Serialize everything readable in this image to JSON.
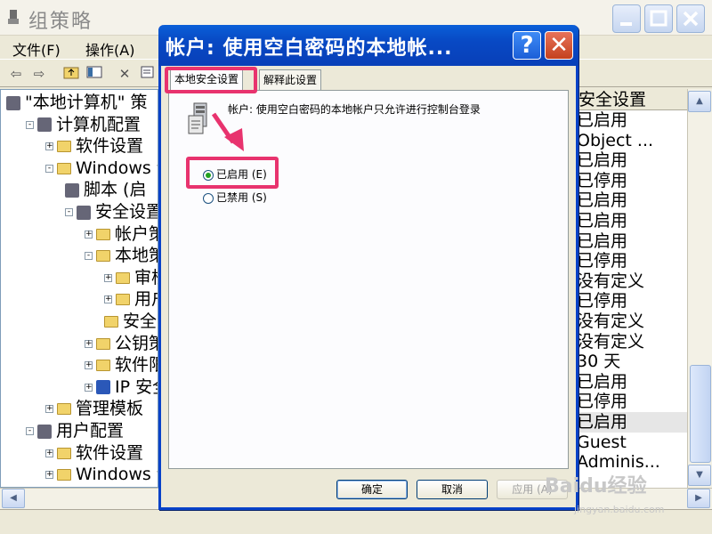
{
  "main_window": {
    "title": "组策略",
    "menu": [
      "文件(F)",
      "操作(A)"
    ],
    "toolbar_icons": [
      "back-arrow-icon",
      "forward-arrow-icon",
      "up-folder-icon",
      "show-hide-tree-icon",
      "delete-icon",
      "properties-icon"
    ],
    "tree": [
      {
        "label": "\"本地计算机\" 策",
        "indent": 0,
        "toggle": "",
        "icon": "policy-icon"
      },
      {
        "label": "计算机配置",
        "indent": 1,
        "toggle": "-",
        "icon": "computer-icon"
      },
      {
        "label": "软件设置",
        "indent": 2,
        "toggle": "+",
        "icon": "folder-icon"
      },
      {
        "label": "Windows 设",
        "indent": 2,
        "toggle": "-",
        "icon": "folder-icon"
      },
      {
        "label": "脚本 (启",
        "indent": 3,
        "toggle": "",
        "icon": "script-icon"
      },
      {
        "label": "安全设置",
        "indent": 3,
        "toggle": "-",
        "icon": "security-icon"
      },
      {
        "label": "帐户策",
        "indent": 4,
        "toggle": "+",
        "icon": "folder-icon"
      },
      {
        "label": "本地策",
        "indent": 4,
        "toggle": "-",
        "icon": "folder-icon"
      },
      {
        "label": "审核",
        "indent": 5,
        "toggle": "+",
        "icon": "folder-icon"
      },
      {
        "label": "用户",
        "indent": 5,
        "toggle": "+",
        "icon": "folder-icon"
      },
      {
        "label": "安全",
        "indent": 5,
        "toggle": "",
        "icon": "folder-icon"
      },
      {
        "label": "公钥策",
        "indent": 4,
        "toggle": "+",
        "icon": "folder-icon"
      },
      {
        "label": "软件限",
        "indent": 4,
        "toggle": "+",
        "icon": "folder-icon"
      },
      {
        "label": "IP 安全",
        "indent": 4,
        "toggle": "+",
        "icon": "ip-security-icon"
      },
      {
        "label": "管理模板",
        "indent": 2,
        "toggle": "+",
        "icon": "folder-icon"
      },
      {
        "label": "用户配置",
        "indent": 1,
        "toggle": "-",
        "icon": "user-icon"
      },
      {
        "label": "软件设置",
        "indent": 2,
        "toggle": "+",
        "icon": "folder-icon"
      },
      {
        "label": "Windows 设",
        "indent": 2,
        "toggle": "+",
        "icon": "folder-icon"
      }
    ],
    "list_header": "安全设置",
    "list_values": [
      "已启用",
      "Object ...",
      "已启用",
      "已停用",
      "已启用",
      "已启用",
      "已启用",
      "已停用",
      "没有定义",
      "已停用",
      "没有定义",
      "没有定义",
      "30 天",
      "已启用",
      "已停用",
      "已启用",
      "Guest",
      "Adminis..."
    ],
    "selected_row": 15
  },
  "dialog": {
    "title": "帐户: 使用空白密码的本地帐...",
    "help_label": "?",
    "close_label": "✕",
    "tabs": [
      "本地安全设置",
      "解释此设置"
    ],
    "description": "帐户: 使用空白密码的本地帐户只允许进行控制台登录",
    "options": [
      {
        "label": "已启用 (E)",
        "checked": true
      },
      {
        "label": "已禁用 (S)",
        "checked": false
      }
    ],
    "buttons": {
      "ok": "确定",
      "cancel": "取消",
      "apply": "应用 (A)"
    }
  },
  "watermark": {
    "brand": "Baidu经验",
    "url": "jingyan.baidu.com"
  },
  "colors": {
    "dialog_title": "#0849c4",
    "highlight": "#e8336e"
  }
}
